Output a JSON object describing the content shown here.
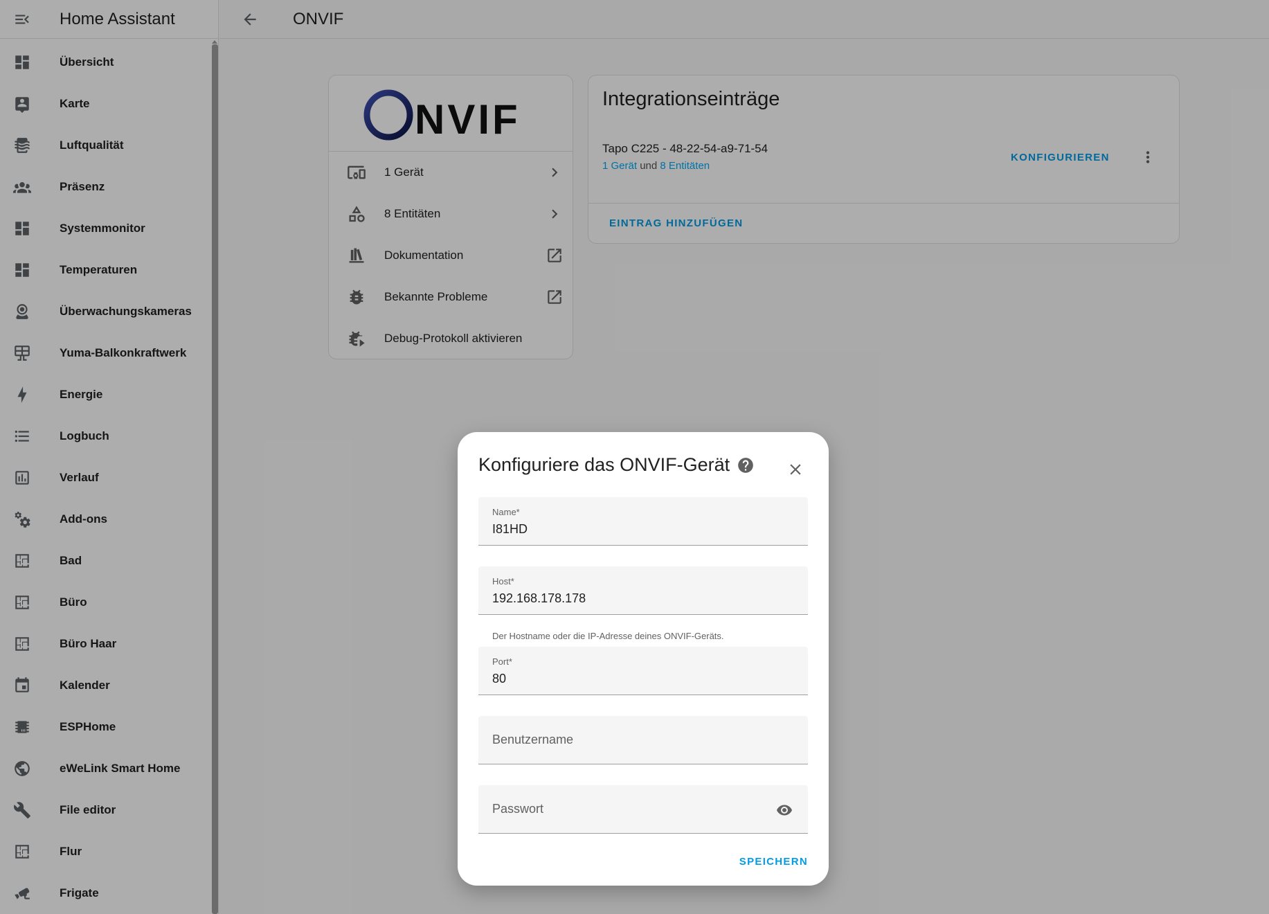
{
  "app": {
    "title": "Home Assistant"
  },
  "sidebar": {
    "items": [
      {
        "label": "Übersicht",
        "icon": "dashboard-icon"
      },
      {
        "label": "Karte",
        "icon": "map-account-icon"
      },
      {
        "label": "Luftqualität",
        "icon": "air-filter-icon"
      },
      {
        "label": "Präsenz",
        "icon": "account-group-icon"
      },
      {
        "label": "Systemmonitor",
        "icon": "dashboard-icon"
      },
      {
        "label": "Temperaturen",
        "icon": "dashboard-icon"
      },
      {
        "label": "Überwachungskameras",
        "icon": "webcam-icon"
      },
      {
        "label": "Yuma-Balkonkraftwerk",
        "icon": "solar-panel-icon"
      },
      {
        "label": "Energie",
        "icon": "lightning-icon"
      },
      {
        "label": "Logbuch",
        "icon": "list-icon"
      },
      {
        "label": "Verlauf",
        "icon": "chart-box-icon"
      },
      {
        "label": "Add-ons",
        "icon": "cogs-icon"
      },
      {
        "label": "Bad",
        "icon": "floor-plan-icon"
      },
      {
        "label": "Büro",
        "icon": "floor-plan-icon"
      },
      {
        "label": "Büro Haar",
        "icon": "floor-plan-icon"
      },
      {
        "label": "Kalender",
        "icon": "calendar-icon"
      },
      {
        "label": "ESPHome",
        "icon": "chip-icon"
      },
      {
        "label": "eWeLink Smart Home",
        "icon": "earth-icon"
      },
      {
        "label": "File editor",
        "icon": "wrench-icon"
      },
      {
        "label": "Flur",
        "icon": "floor-plan-icon"
      },
      {
        "label": "Frigate",
        "icon": "cctv-icon"
      }
    ]
  },
  "header": {
    "title": "ONVIF"
  },
  "info_card": {
    "logo_text": "ONVIF",
    "rows": [
      {
        "label": "1 Gerät",
        "icon": "devices-icon",
        "trail": "chevron-right-icon"
      },
      {
        "label": "8 Entitäten",
        "icon": "shape-icon",
        "trail": "chevron-right-icon"
      },
      {
        "label": "Dokumentation",
        "icon": "bookshelf-icon",
        "trail": "open-in-new-icon"
      },
      {
        "label": "Bekannte Probleme",
        "icon": "bug-icon",
        "trail": "open-in-new-icon"
      },
      {
        "label": "Debug-Protokoll aktivieren",
        "icon": "bug-play-icon",
        "trail": ""
      }
    ]
  },
  "entries_card": {
    "title": "Integrationseinträge",
    "entry": {
      "name": "Tapo C225 - 48-22-54-a9-71-54",
      "devices_link": "1 Gerät",
      "and_text": " und ",
      "entities_link": "8 Entitäten",
      "configure_label": "KONFIGURIEREN"
    },
    "add_entry_label": "EINTRAG HINZUFÜGEN"
  },
  "dialog": {
    "title": "Konfiguriere das ONVIF-Gerät",
    "fields": {
      "name": {
        "label": "Name*",
        "value": "I81HD"
      },
      "host": {
        "label": "Host*",
        "value": "192.168.178.178",
        "helper": "Der Hostname oder die IP-Adresse deines ONVIF-Geräts."
      },
      "port": {
        "label": "Port*",
        "value": "80"
      },
      "username": {
        "placeholder": "Benutzername"
      },
      "password": {
        "placeholder": "Passwort"
      }
    },
    "save_label": "SPEICHERN"
  },
  "colors": {
    "accent": "#039be5",
    "onvif_navy": "#1a237e",
    "onvif_dark": "#111111"
  }
}
